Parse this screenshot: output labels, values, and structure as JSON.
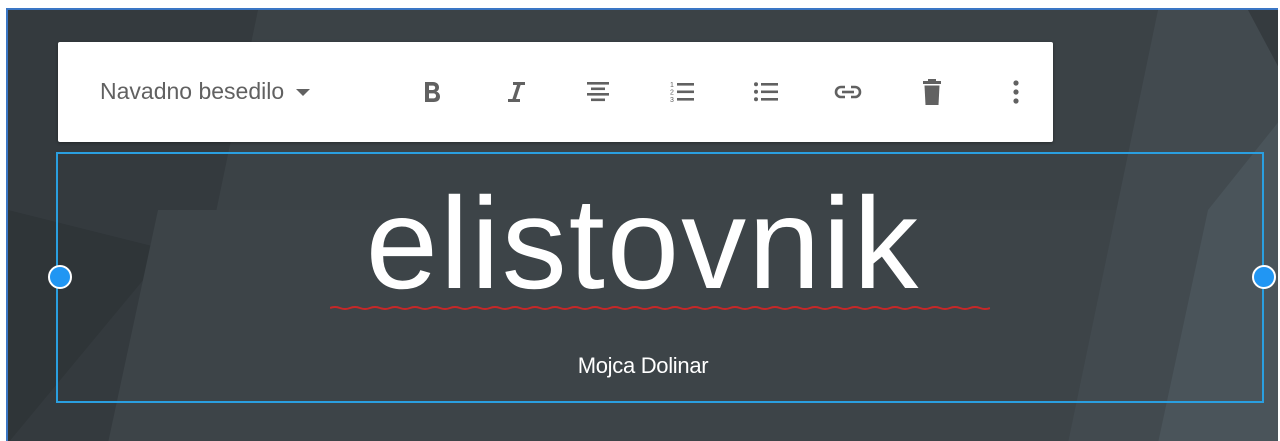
{
  "toolbar": {
    "text_style": "Navadno besedilo",
    "buttons": [
      {
        "name": "bold-button",
        "icon": "bold-icon"
      },
      {
        "name": "italic-button",
        "icon": "italic-icon"
      },
      {
        "name": "align-center-button",
        "icon": "align-center-icon"
      },
      {
        "name": "numbered-list-button",
        "icon": "numbered-list-icon"
      },
      {
        "name": "bulleted-list-button",
        "icon": "bulleted-list-icon"
      },
      {
        "name": "link-button",
        "icon": "link-icon"
      },
      {
        "name": "delete-button",
        "icon": "trash-icon"
      },
      {
        "name": "more-options-button",
        "icon": "more-vertical-icon"
      }
    ]
  },
  "header": {
    "title": "elistovnik",
    "subtitle": "Mojca Dolinar"
  },
  "colors": {
    "background": "#3b4246",
    "selection": "#2a9fe0",
    "handle": "#2196f3",
    "spellcheck": "#c62828",
    "toolbar_icon": "#616161"
  }
}
